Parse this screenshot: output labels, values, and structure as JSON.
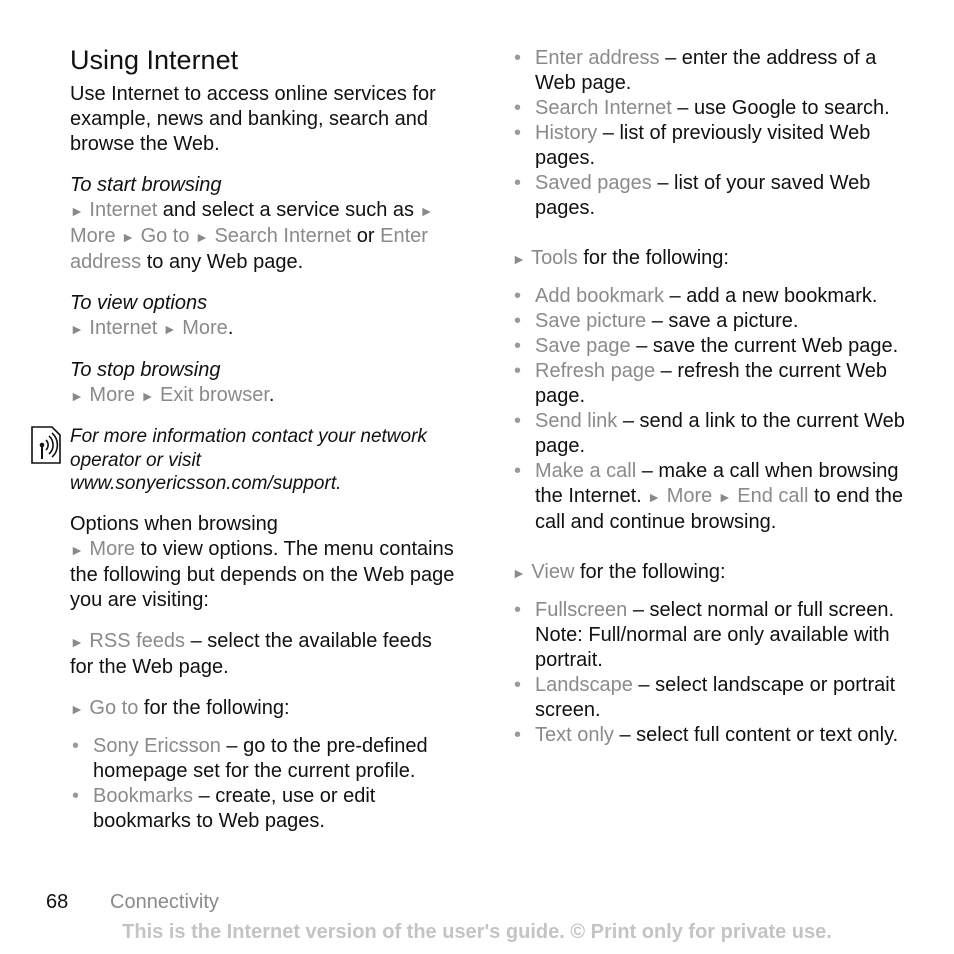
{
  "title": "Using Internet",
  "intro": "Use Internet to access online services for example, news and banking, search and browse the Web.",
  "start": {
    "heading": "To start browsing",
    "m1": "Internet",
    "t1": " and select a service such as ",
    "m2": "More",
    "m3": "Go to",
    "m4": "Search Internet",
    "t2": " or ",
    "m5": "Enter address",
    "t3": " to any Web page."
  },
  "view": {
    "heading": "To view options",
    "m1": "Internet",
    "m2": "More",
    "t1": "."
  },
  "stop": {
    "heading": "To stop browsing",
    "m1": "More",
    "m2": "Exit browser",
    "t1": "."
  },
  "note": "For more information contact your network operator or visit www.sonyericsson.com/support.",
  "options": {
    "heading": "Options when browsing",
    "m1": "More",
    "t1": " to view options. The menu contains the following but depends on the Web page you are visiting:",
    "rss": "RSS feeds",
    "rss_desc": " – select the available feeds for the Web page.",
    "goto": "Go to",
    "goto_desc": " for the following:",
    "goto_items": [
      {
        "term": "Sony Ericsson",
        "desc": " – go to the pre-defined homepage set for the current profile."
      },
      {
        "term": "Bookmarks",
        "desc": " – create, use or edit bookmarks to Web pages."
      },
      {
        "term": "Enter address",
        "desc": " – enter the address of a Web page."
      },
      {
        "term": "Search Internet",
        "desc": " – use Google to search."
      },
      {
        "term": "History",
        "desc": " – list of previously visited Web pages."
      },
      {
        "term": "Saved pages",
        "desc": " – list of your saved Web pages."
      }
    ],
    "tools": "Tools",
    "tools_desc": " for the following:",
    "tools_items": [
      {
        "term": "Add bookmark",
        "desc": " – add a new bookmark."
      },
      {
        "term": "Save picture",
        "desc": " – save a picture."
      },
      {
        "term": "Save page",
        "desc": " – save the current Web page."
      },
      {
        "term": "Refresh page",
        "desc": " – refresh the current Web page."
      },
      {
        "term": "Send link",
        "desc": " – send a link to the current Web page."
      },
      {
        "term": "Make a call",
        "desc": " – make a call when browsing the Internet. "
      }
    ],
    "call_m1": "More",
    "call_m2": "End call",
    "call_t": " to end the call and continue browsing.",
    "view": "View",
    "view_desc": " for the following:",
    "view_items": [
      {
        "term": "Fullscreen",
        "desc": " – select normal or full screen. Note: Full/normal are only available with portrait."
      },
      {
        "term": "Landscape",
        "desc": " – select landscape or portrait screen."
      },
      {
        "term": "Text only",
        "desc": " – select full content or text only."
      }
    ]
  },
  "arrow": "►",
  "footer": {
    "page": "68",
    "section": "Connectivity",
    "notice": "This is the Internet version of the user's guide. © Print only for private use."
  }
}
